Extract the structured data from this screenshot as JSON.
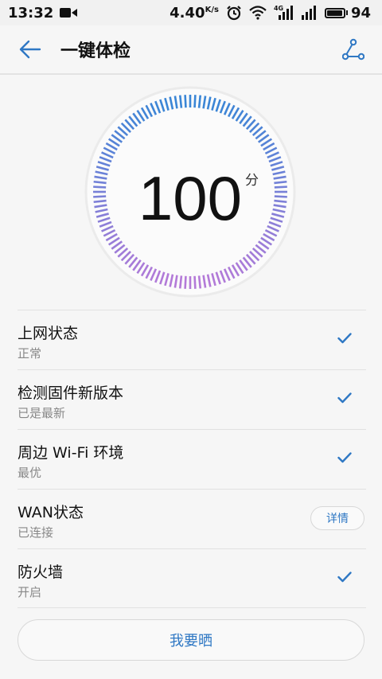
{
  "status_bar": {
    "time": "13:32",
    "speed_value": "4.40",
    "speed_unit": "K/s",
    "network_label": "4G",
    "battery": "94",
    "icons": [
      "video-record-icon",
      "alarm-icon",
      "wifi-icon",
      "signal-4g-icon",
      "signal-icon",
      "battery-icon"
    ]
  },
  "app_bar": {
    "title": "一键体检",
    "back_icon": "arrow-left-icon",
    "share_icon": "share-icon"
  },
  "gauge": {
    "score": "100",
    "unit": "分",
    "level": 1.0,
    "colors": {
      "start": "#3a86d6",
      "end": "#b47ad8",
      "track": "#ebebeb"
    }
  },
  "checks": [
    {
      "title": "上网状态",
      "status": "正常",
      "action": "check"
    },
    {
      "title": "检测固件新版本",
      "status": "已是最新",
      "action": "check"
    },
    {
      "title": "周边 Wi-Fi 环境",
      "status": "最优",
      "action": "check"
    },
    {
      "title": "WAN状态",
      "status": "已连接",
      "action": "detail",
      "action_label": "详情"
    },
    {
      "title": "防火墙",
      "status": "开启",
      "action": "check"
    }
  ],
  "share_button_label": "我要晒",
  "accent_color": "#2f78c4"
}
